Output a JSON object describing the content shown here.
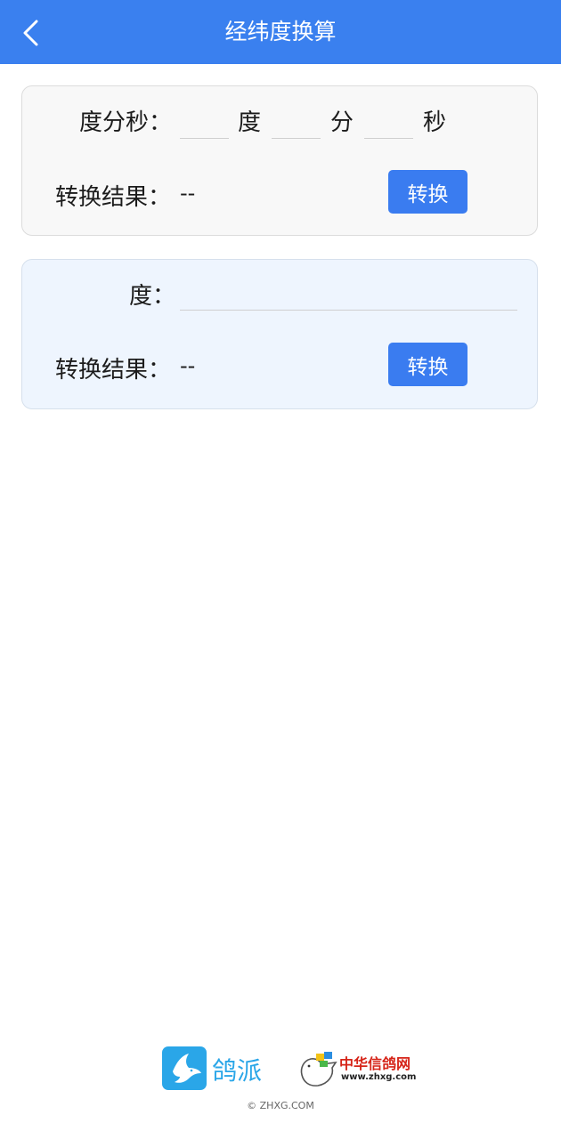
{
  "appbar": {
    "title": "经纬度换算",
    "back_icon": "chevron-left-icon"
  },
  "dms_card": {
    "label": "度分秒：",
    "degree_unit": "度",
    "minute_unit": "分",
    "second_unit": "秒",
    "degree_value": "",
    "minute_value": "",
    "second_value": "",
    "result_label": "转换结果：",
    "result_value": "--",
    "convert_label": "转换"
  },
  "deg_card": {
    "label": "度：",
    "degree_value": "",
    "result_label": "转换结果：",
    "result_value": "--",
    "convert_label": "转换"
  },
  "footer": {
    "gepai_name": "鸽派",
    "zhxg_name": "中华信鸽网",
    "zhxg_url": "www.zhxg.com",
    "copyright": "© ZHXG.COM"
  },
  "colors": {
    "appbar": "#3a80ef",
    "button": "#3a7cf0",
    "card1_bg": "#f8f8f8",
    "card2_bg": "#eef5fe"
  }
}
